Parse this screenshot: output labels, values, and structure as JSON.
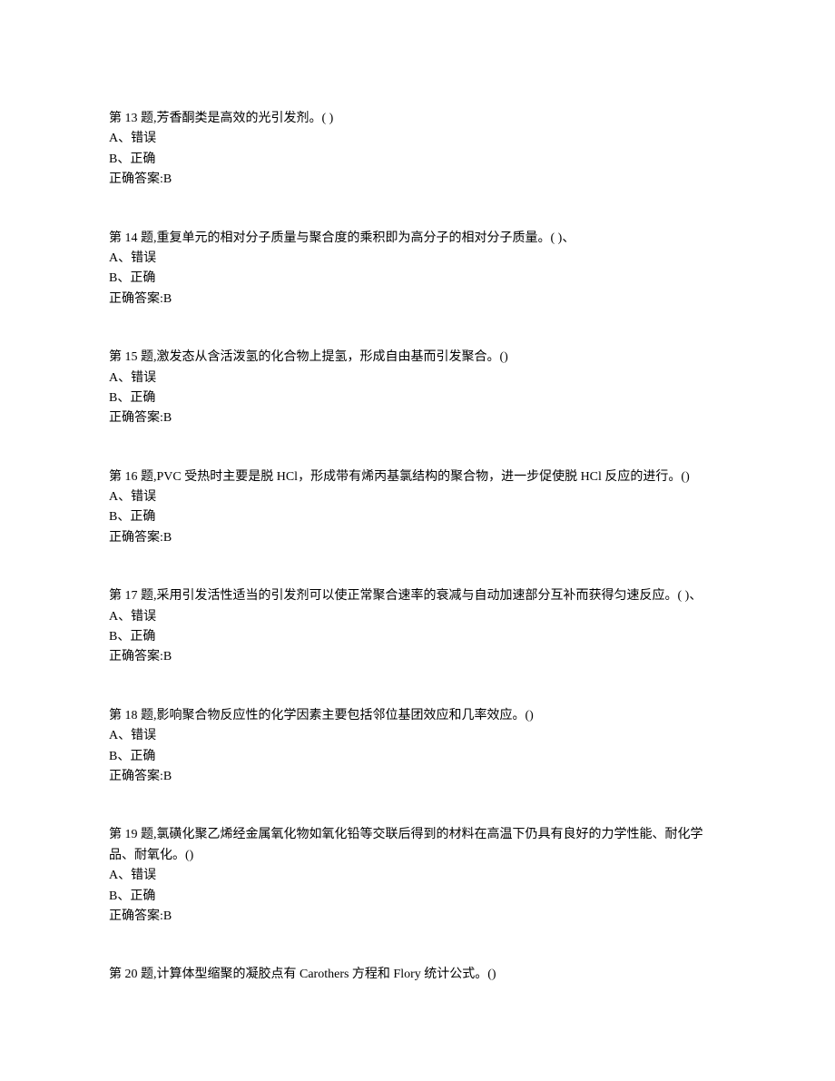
{
  "questions": [
    {
      "num": "第 13 题,芳香酮类是高效的光引发剂。(      )",
      "optA": "A、错误",
      "optB": "B、正确",
      "answer": "正确答案:B"
    },
    {
      "num": "第 14 题,重复单元的相对分子质量与聚合度的乘积即为高分子的相对分子质量。(      )、",
      "optA": "A、错误",
      "optB": "B、正确",
      "answer": "正确答案:B"
    },
    {
      "num": "第 15 题,激发态从含活泼氢的化合物上提氢，形成自由基而引发聚合。()",
      "optA": "A、错误",
      "optB": "B、正确",
      "answer": "正确答案:B"
    },
    {
      "num": "第 16 题,PVC 受热时主要是脱 HCl，形成带有烯丙基氯结构的聚合物，进一步促使脱 HCl 反应的进行。()",
      "optA": "A、错误",
      "optB": "B、正确",
      "answer": "正确答案:B"
    },
    {
      "num": "第 17 题,采用引发活性适当的引发剂可以使正常聚合速率的衰减与自动加速部分互补而获得匀速反应。(      )、",
      "optA": "A、错误",
      "optB": "B、正确",
      "answer": "正确答案:B"
    },
    {
      "num": "第 18 题,影响聚合物反应性的化学因素主要包括邻位基团效应和几率效应。()",
      "optA": "A、错误",
      "optB": "B、正确",
      "answer": "正确答案:B"
    },
    {
      "num": "第 19 题,氯磺化聚乙烯经金属氧化物如氧化铅等交联后得到的材料在高温下仍具有良好的力学性能、耐化学品、耐氧化。()",
      "optA": "A、错误",
      "optB": "B、正确",
      "answer": "正确答案:B"
    },
    {
      "num": "第 20 题,计算体型缩聚的凝胶点有 Carothers 方程和 Flory 统计公式。()",
      "optA": "",
      "optB": "",
      "answer": ""
    }
  ]
}
